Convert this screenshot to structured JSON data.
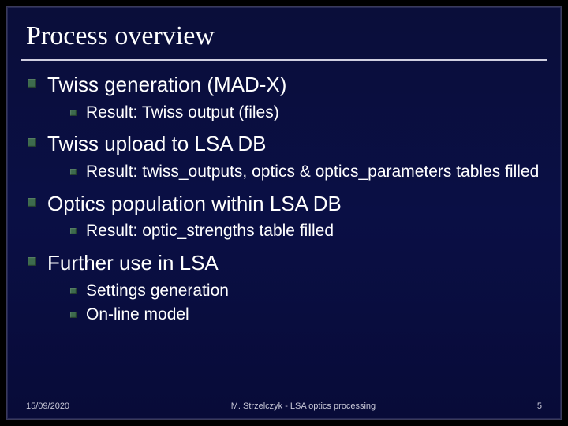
{
  "slide": {
    "title": "Process overview",
    "bullets": [
      {
        "text": "Twiss generation (MAD-X)",
        "children": [
          {
            "text": "Result: Twiss output (files)"
          }
        ]
      },
      {
        "text": "Twiss upload to LSA DB",
        "children": [
          {
            "text": "Result: twiss_outputs, optics & optics_parameters tables filled"
          }
        ]
      },
      {
        "text": "Optics population within LSA DB",
        "children": [
          {
            "text": "Result: optic_strengths table filled"
          }
        ]
      },
      {
        "text": "Further use in LSA",
        "children": [
          {
            "text": "Settings generation"
          },
          {
            "text": "On-line model"
          }
        ]
      }
    ],
    "footer": {
      "date": "15/09/2020",
      "center": "M. Strzelczyk - LSA optics processing",
      "page": "5"
    }
  }
}
